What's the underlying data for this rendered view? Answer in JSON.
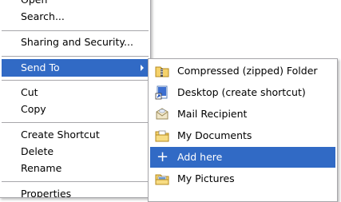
{
  "main_menu": {
    "items": [
      {
        "label": "Open"
      },
      {
        "label": "Search..."
      },
      {
        "label": "Sharing and Security..."
      },
      {
        "label": "Send To"
      },
      {
        "label": "Cut"
      },
      {
        "label": "Copy"
      },
      {
        "label": "Create Shortcut"
      },
      {
        "label": "Delete"
      },
      {
        "label": "Rename"
      },
      {
        "label": "Properties"
      }
    ]
  },
  "send_to_menu": {
    "items": [
      {
        "label": "Compressed (zipped) Folder",
        "icon": "zip-folder-icon"
      },
      {
        "label": "Desktop (create shortcut)",
        "icon": "desktop-shortcut-icon"
      },
      {
        "label": "Mail Recipient",
        "icon": "mail-envelope-icon"
      },
      {
        "label": "My Documents",
        "icon": "documents-folder-icon"
      },
      {
        "label": "Add here",
        "icon": "plus-icon"
      },
      {
        "label": "My Pictures",
        "icon": "pictures-folder-icon"
      }
    ]
  },
  "colors": {
    "highlight": "#316ac5",
    "separator": "#a7a6aa",
    "menu_bg": "#ffffff"
  }
}
